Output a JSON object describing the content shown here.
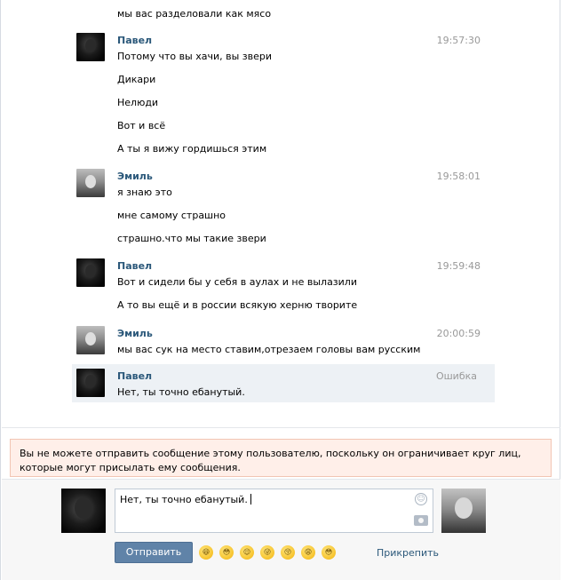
{
  "top_line": "мы вас разделовали как мясо",
  "messages": [
    {
      "author": "Павел",
      "time": "19:57:30",
      "lines": [
        "Потому что вы хачи, вы звери",
        "Дикари",
        "Нелюди",
        "Вот и всё",
        "А ты я вижу гордишься этим"
      ]
    },
    {
      "author": "Эмиль",
      "time": "19:58:01",
      "lines": [
        "я знаю это",
        "мне самому страшно",
        "страшно.что мы такие звери"
      ]
    },
    {
      "author": "Павел",
      "time": "19:59:48",
      "lines": [
        "Вот и сидели бы у себя в аулах и не вылазили",
        "А то вы ещё и в россии всякую херню творите"
      ]
    },
    {
      "author": "Эмиль",
      "time": "20:00:59",
      "lines": [
        "мы вас сук на место ставим,отрезаем головы вам русским"
      ]
    },
    {
      "author": "Павел",
      "time": "Ошибка",
      "lines": [
        "Нет, ты точно ебанутый."
      ]
    }
  ],
  "warning": "Вы не можете отправить сообщение этому пользователю, поскольку он ограничивает круг лиц, которые могут присылать ему сообщения.",
  "composer": {
    "input_value": "Нет, ты точно ебанутый.",
    "send_label": "Отправить",
    "attach_label": "Прикрепить",
    "emojis": [
      "😆",
      "😳",
      "😌",
      "😜",
      "😚",
      "😩",
      "😳"
    ]
  },
  "colors": {
    "author": "#2b587a",
    "time": "#999999",
    "send_button": "#6083a8",
    "warning_bg": "#ffefe9"
  }
}
